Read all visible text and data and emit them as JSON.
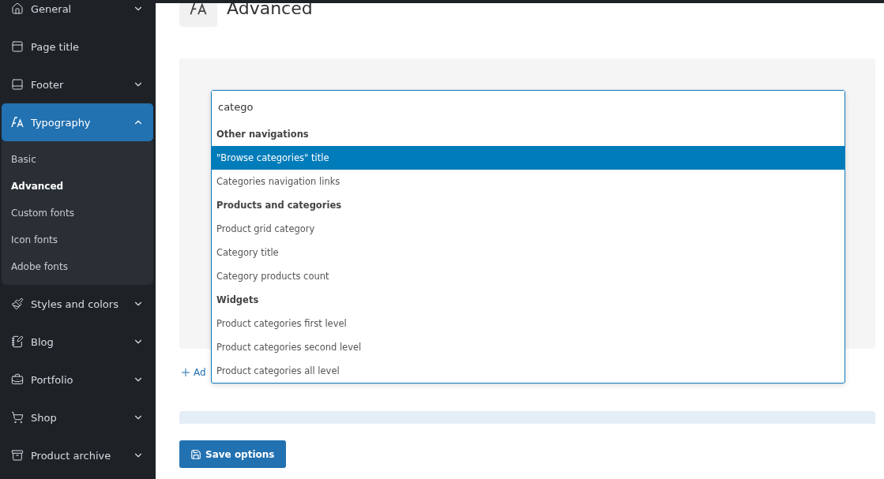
{
  "sidebar": {
    "items": [
      {
        "label": "General",
        "kind": "group",
        "expanded": false
      },
      {
        "label": "Page title",
        "kind": "link"
      },
      {
        "label": "Footer",
        "kind": "group",
        "expanded": false
      },
      {
        "label": "Typography",
        "kind": "group",
        "expanded": true,
        "selected": true,
        "children": [
          {
            "label": "Basic",
            "selected": false
          },
          {
            "label": "Advanced",
            "selected": true
          },
          {
            "label": "Custom fonts",
            "selected": false
          },
          {
            "label": "Icon fonts",
            "selected": false
          },
          {
            "label": "Adobe fonts",
            "selected": false
          }
        ]
      },
      {
        "label": "Styles and colors",
        "kind": "group",
        "expanded": false
      },
      {
        "label": "Blog",
        "kind": "group",
        "expanded": false
      },
      {
        "label": "Portfolio",
        "kind": "group",
        "expanded": false
      },
      {
        "label": "Shop",
        "kind": "group",
        "expanded": false
      },
      {
        "label": "Product archive",
        "kind": "group",
        "expanded": false
      }
    ]
  },
  "page": {
    "title": "Advanced"
  },
  "search": {
    "value": "catego"
  },
  "dropdown": [
    {
      "kind": "group",
      "label": "Other navigations"
    },
    {
      "kind": "option",
      "label": "\"Browse categories\" title",
      "selected": true
    },
    {
      "kind": "option",
      "label": "Categories navigation links",
      "selected": false
    },
    {
      "kind": "group",
      "label": "Products and categories"
    },
    {
      "kind": "option",
      "label": "Product grid category",
      "selected": false
    },
    {
      "kind": "option",
      "label": "Category title",
      "selected": false
    },
    {
      "kind": "option",
      "label": "Category products count",
      "selected": false
    },
    {
      "kind": "group",
      "label": "Widgets"
    },
    {
      "kind": "option",
      "label": "Product categories first level",
      "selected": false
    },
    {
      "kind": "option",
      "label": "Product categories second level",
      "selected": false
    },
    {
      "kind": "option",
      "label": "Product categories all level",
      "selected": false
    }
  ],
  "add_link": {
    "label": "Ad"
  },
  "save_button": {
    "label": "Save options"
  }
}
